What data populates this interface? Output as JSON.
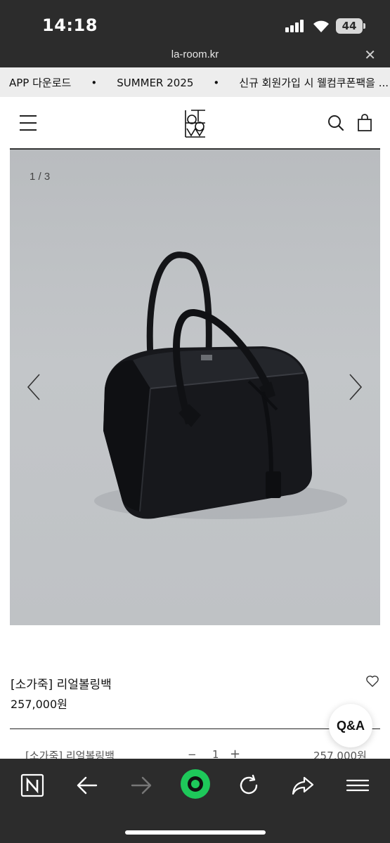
{
  "status_bar": {
    "time": "14:18",
    "battery": "44"
  },
  "browser": {
    "url": "la-room.kr"
  },
  "marquee": {
    "items": [
      "APP 다운로드",
      "SUMMER 2025",
      "신규 회원가입 시 웰컴쿠폰팩을 ..."
    ],
    "separator": "•"
  },
  "gallery": {
    "counter": "1 / 3"
  },
  "product": {
    "name": "[소가죽] 리얼볼링백",
    "price": "257,000원"
  },
  "qa_button": {
    "label": "Q&A"
  },
  "option": {
    "name": "[소가죽] 리얼볼링백",
    "minus": "−",
    "quantity": "1",
    "plus": "+",
    "price": "257,000원"
  },
  "icons": {
    "hamburger": "menu-icon",
    "search": "search-icon",
    "cart": "shopping-bag-icon",
    "wish": "heart-icon",
    "prev": "chevron-left-icon",
    "next": "chevron-right-icon",
    "toolbar": [
      "naver-n-icon",
      "back-arrow-icon",
      "forward-arrow-icon",
      "green-home-icon",
      "refresh-icon",
      "share-icon",
      "menu-icon"
    ]
  },
  "colors": {
    "status_bg": "#2c2c2c",
    "marquee_bg": "#ededed",
    "green_accent": "#1ec85a",
    "photo_bg": "#bfc2c5"
  }
}
